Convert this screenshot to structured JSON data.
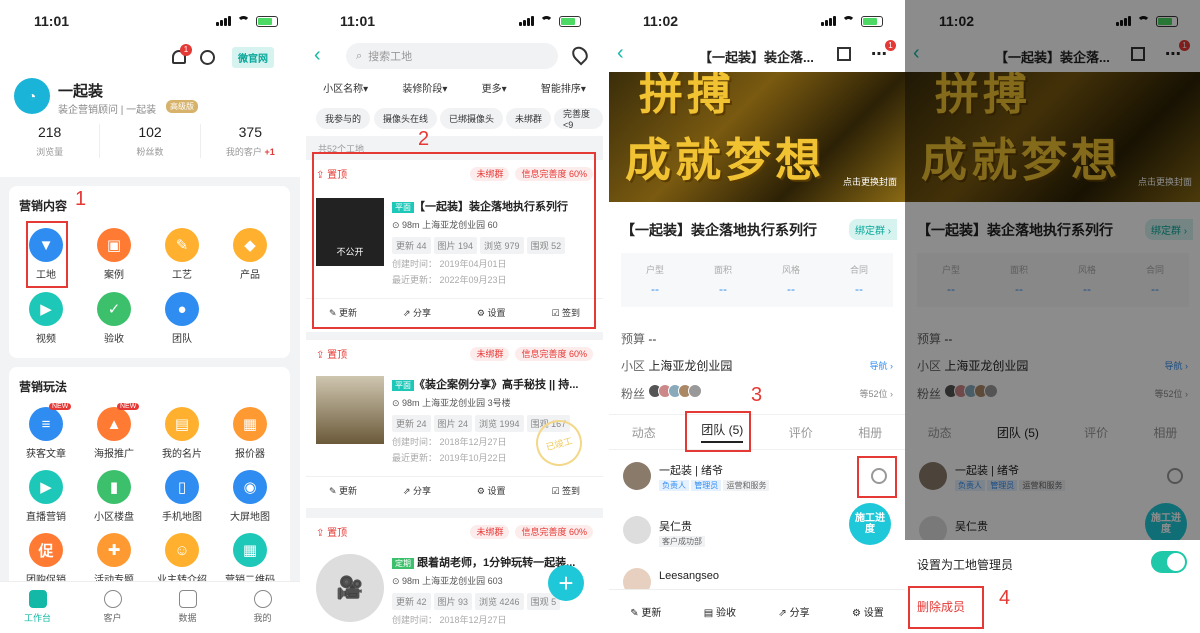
{
  "panel1": {
    "time": "11:01",
    "bell_badge": "1",
    "official_site": "微官网",
    "profile": {
      "name": "一起装",
      "subtitle": "装企营销顾问 | 一起装",
      "level": "高级版"
    },
    "stats": [
      {
        "value": "218",
        "label": "浏览量"
      },
      {
        "value": "102",
        "label": "粉丝数"
      },
      {
        "value": "375",
        "label": "我的客户",
        "delta": "+1"
      }
    ],
    "content_section": {
      "title": "营销内容",
      "marker": "1",
      "items": [
        {
          "label": "工地",
          "icon": "brush-icon",
          "color": "#2f8cf0"
        },
        {
          "label": "案例",
          "icon": "case-icon",
          "color": "#ff7a33"
        },
        {
          "label": "工艺",
          "icon": "pencil-icon",
          "color": "#ffb02e"
        },
        {
          "label": "产品",
          "icon": "box-icon",
          "color": "#ffb02e"
        },
        {
          "label": "视频",
          "icon": "video-icon",
          "color": "#1ec8b8"
        },
        {
          "label": "验收",
          "icon": "check-doc-icon",
          "color": "#3cc06c"
        },
        {
          "label": "团队",
          "icon": "person-icon",
          "color": "#2f8cf0"
        }
      ]
    },
    "play_section": {
      "title": "营销玩法",
      "items": [
        {
          "label": "获客文章",
          "icon": "article-icon",
          "color": "#2f8cf0",
          "badge": "NEW"
        },
        {
          "label": "海报推广",
          "icon": "poster-icon",
          "color": "#ff7a33",
          "badge": "NEW"
        },
        {
          "label": "我的名片",
          "icon": "card-icon",
          "color": "#ffb02e"
        },
        {
          "label": "报价器",
          "icon": "calculator-icon",
          "color": "#ff9a33"
        },
        {
          "label": "直播营销",
          "icon": "live-icon",
          "color": "#1ec8b8"
        },
        {
          "label": "小区楼盘",
          "icon": "building-icon",
          "color": "#3cc06c"
        },
        {
          "label": "手机地图",
          "icon": "phone-icon",
          "color": "#2f8cf0"
        },
        {
          "label": "大屏地图",
          "icon": "map-icon",
          "color": "#2f8cf0"
        },
        {
          "label": "团购促销",
          "icon": "promo-icon",
          "color": "#ff7a33"
        },
        {
          "label": "活动专题",
          "icon": "gift-icon",
          "color": "#ff9a33"
        },
        {
          "label": "业主转介绍",
          "icon": "referral-icon",
          "color": "#ffb02e"
        },
        {
          "label": "营销二维码",
          "icon": "qrcode-icon",
          "color": "#1ec8b8"
        }
      ]
    },
    "tabs": [
      {
        "label": "工作台",
        "icon": "workbench-icon",
        "active": true
      },
      {
        "label": "客户",
        "icon": "customer-icon"
      },
      {
        "label": "数据",
        "icon": "chart-icon"
      },
      {
        "label": "我的",
        "icon": "smile-icon"
      }
    ]
  },
  "panel2": {
    "time": "11:01",
    "search_placeholder": "搜索工地",
    "filters": [
      "小区名称",
      "装修阶段",
      "更多",
      "智能排序"
    ],
    "chips": [
      "我参与的",
      "摄像头在线",
      "已绑摄像头",
      "未绑群",
      "完善度<9"
    ],
    "count_text": "共52个工地",
    "marker": "2",
    "sites": [
      {
        "pin": "置顶",
        "group": "未绑群",
        "complete": "信息完善度 60%",
        "type": "平面",
        "title": "【一起装】装企落地执行系列行",
        "dist": "98m",
        "addr": "上海亚龙创业园  60",
        "tags": [
          "更新 44",
          "图片 194",
          "浏览 979",
          "围观 52"
        ],
        "created": "创建时间：  2019年04月01日",
        "updated": "最近更新：  2022年09月23日",
        "thumb_label": "不公开",
        "actions": [
          "更新",
          "分享",
          "设置",
          "签到"
        ]
      },
      {
        "pin": "置顶",
        "group": "未绑群",
        "complete": "信息完善度 60%",
        "type": "平面",
        "title": "《装企案例分享》高手秘技 || 持...",
        "dist": "98m",
        "addr": "上海亚龙创业园 3号楼",
        "tags": [
          "更新 24",
          "图片 24",
          "浏览 1994",
          "围观 167"
        ],
        "created": "创建时间：  2018年12月27日",
        "updated": "最近更新：  2019年10月22日",
        "stamp": "已竣工",
        "actions": [
          "更新",
          "分享",
          "设置",
          "签到"
        ]
      },
      {
        "pin": "置顶",
        "group": "未绑群",
        "complete": "信息完善度 60%",
        "type": "定期",
        "title": "跟着胡老师，1分钟玩转一起装...",
        "dist": "98m",
        "addr": "上海亚龙创业园 603",
        "tags": [
          "更新 42",
          "图片 93",
          "浏览 4246",
          "围观 5"
        ],
        "created": "创建时间：  2018年12月27日"
      }
    ]
  },
  "panel3": {
    "time": "11:02",
    "title": "【一起装】装企落...",
    "more_badge": "1",
    "cover_text": [
      "拼搏",
      "成就梦想"
    ],
    "cover_action": "点击更换封面",
    "site_name": "【一起装】装企落地执行系列行",
    "bind_group": "绑定群",
    "specs": [
      {
        "label": "户型",
        "value": "--"
      },
      {
        "label": "面积",
        "value": "--"
      },
      {
        "label": "风格",
        "value": "--"
      },
      {
        "label": "合同",
        "value": "--"
      }
    ],
    "budget_label": "预算",
    "budget_value": "--",
    "community_label": "小区",
    "community_value": "上海亚龙创业园",
    "nav": "导航",
    "fans_label": "粉丝",
    "fans_count": "等52位",
    "tabs": [
      "动态",
      "团队 (5)",
      "评价",
      "相册"
    ],
    "marker": "3",
    "members": [
      {
        "name": "一起装 | 绪爷",
        "roles": [
          "负责人",
          "管理员",
          "运营和服务"
        ]
      },
      {
        "name": "吴仁贵",
        "roles": [
          "客户成功部"
        ]
      },
      {
        "name": "Leesangseo",
        "roles": []
      }
    ],
    "float_button": "施工进度",
    "actions": [
      "更新",
      "验收",
      "分享",
      "设置"
    ]
  },
  "panel4": {
    "time": "11:02",
    "set_admin": "设置为工地管理员",
    "delete_member": "删除成员",
    "marker": "4"
  }
}
